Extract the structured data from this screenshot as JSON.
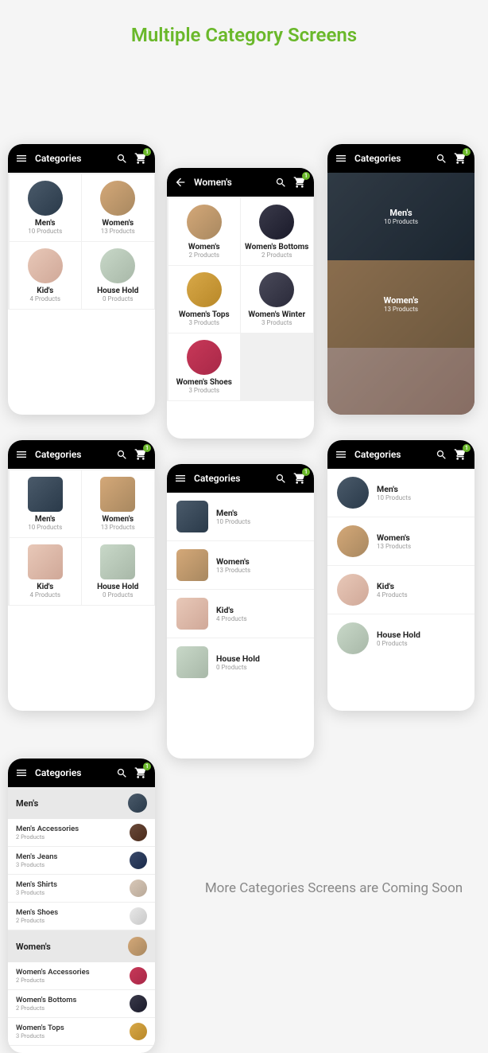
{
  "page_title": "Multiple Category Screens",
  "coming_soon": "More Categories Screens are Coming Soon",
  "cart_badge": "1",
  "topbar": {
    "categories": "Categories",
    "women": "Women's"
  },
  "cats": {
    "men": {
      "name": "Men's",
      "sub": "10 Products"
    },
    "women": {
      "name": "Women's",
      "sub": "13 Products"
    },
    "kids": {
      "name": "Kid's",
      "sub": "4 Products"
    },
    "house": {
      "name": "House Hold",
      "sub": "0 Products"
    }
  },
  "women_sub": {
    "women": {
      "name": "Women's",
      "sub": "2 Products"
    },
    "bottoms": {
      "name": "Women's Bottoms",
      "sub": "2 Products"
    },
    "tops": {
      "name": "Women's Tops",
      "sub": "3 Products"
    },
    "winter": {
      "name": "Women's Winter",
      "sub": "3 Products"
    },
    "shoes": {
      "name": "Women's Shoes",
      "sub": "3 Products"
    }
  },
  "tree": {
    "men": {
      "name": "Men's"
    },
    "men_items": {
      "acc": {
        "name": "Men's Accessories",
        "sub": "2 Products"
      },
      "jeans": {
        "name": "Men's Jeans",
        "sub": "3 Products"
      },
      "shirts": {
        "name": "Men's Shirts",
        "sub": "3 Products"
      },
      "shoes": {
        "name": "Men's Shoes",
        "sub": "2 Products"
      }
    },
    "women": {
      "name": "Women's"
    },
    "women_items": {
      "acc": {
        "name": "Women's Accessories",
        "sub": "2 Products"
      },
      "bottoms": {
        "name": "Women's Bottoms",
        "sub": "2 Products"
      },
      "tops": {
        "name": "Women's Tops",
        "sub": "3 Products"
      }
    }
  }
}
